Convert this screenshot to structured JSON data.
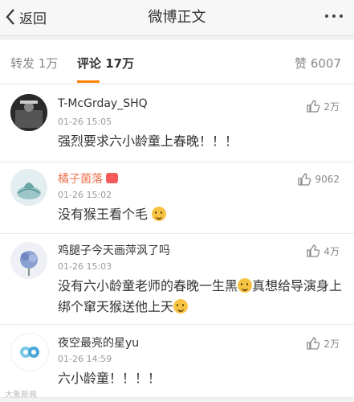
{
  "nav": {
    "back_label": "返回",
    "title": "微博正文"
  },
  "tabs": {
    "repost": "转发 1万",
    "comment": "评论 17万",
    "like": "赞 6007"
  },
  "comments": [
    {
      "user": "T-McGrday_SHQ",
      "time": "01-26 15:05",
      "text": "强烈要求六小龄童上春晚！！！",
      "likes": "2万"
    },
    {
      "user": "橘子菌落",
      "time": "01-26 15:02",
      "text": "没有猴王看个毛",
      "likes": "9062"
    },
    {
      "user": "鸡腿子今天画萍沨了吗",
      "time": "01-26 15:03",
      "text": "没有六小龄童老师的春晚一生黑",
      "text2": "真想给导演身上绑个窜天猴送他上天",
      "likes": "4万"
    },
    {
      "user": "夜空最亮的星yu",
      "time": "01-26 14:59",
      "text": "六小龄童！！！！",
      "likes": "2万"
    }
  ],
  "watermark": "大象新闻",
  "colors": {
    "accent": "#ff8200",
    "vip_name": "#eb7350",
    "emoji": "#f6c343"
  }
}
